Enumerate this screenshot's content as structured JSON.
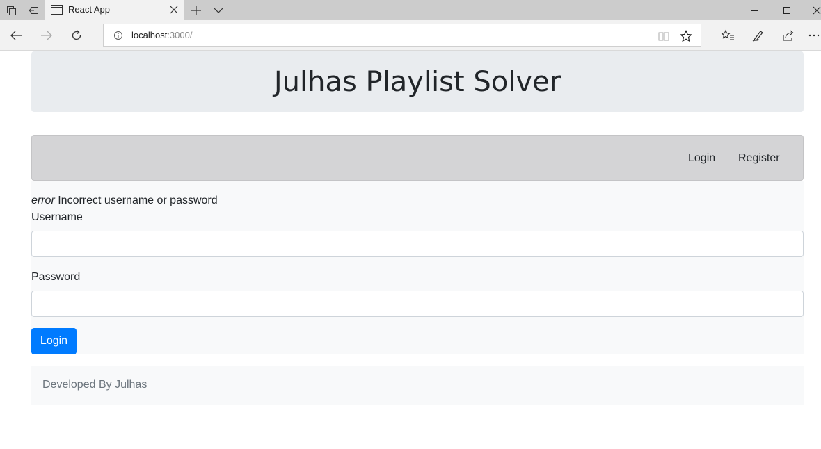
{
  "browser": {
    "tab_title": "React App",
    "url_host": "localhost",
    "url_port": ":3000/"
  },
  "page": {
    "site_title": "Julhas Playlist Solver",
    "nav": {
      "login": "Login",
      "register": "Register"
    },
    "error": {
      "prefix": "error",
      "message": " Incorrect username or password"
    },
    "form": {
      "username_label": "Username",
      "username_value": "",
      "password_label": "Password",
      "password_value": "",
      "submit_label": "Login"
    },
    "footer": "Developed By Julhas"
  },
  "icons": {
    "tab_actions": [
      "tab-preview-icon",
      "set-aside-tabs-icon"
    ],
    "tab": [
      "page-favicon-icon",
      "close-tab-icon"
    ],
    "new_tab": [
      "plus-icon",
      "chevron-down-icon"
    ],
    "window": [
      "minimize-icon",
      "maximize-icon",
      "close-window-icon"
    ],
    "nav": [
      "back-icon",
      "forward-icon",
      "refresh-icon"
    ],
    "address": [
      "info-icon",
      "reading-view-icon",
      "star-icon"
    ],
    "toolbar": [
      "favorites-icon",
      "pen-icon",
      "share-icon",
      "more-icon"
    ]
  }
}
